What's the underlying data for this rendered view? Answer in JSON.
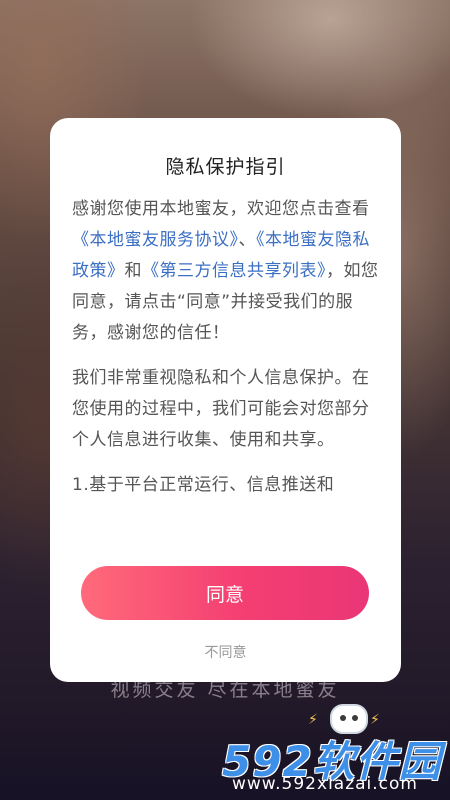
{
  "dialog": {
    "title": "隐私保护指引",
    "para1": {
      "text_before": "感谢您使用本地蜜友，欢迎您点击查看",
      "link_service": "《本地蜜友服务协议》",
      "sep1": "、",
      "link_privacy": "《本地蜜友隐私政策》",
      "sep2": "和",
      "link_thirdparty": "《第三方信息共享列表》",
      "text_after": "，如您同意，请点击“同意”并接受我们的服务，感谢您的信任！"
    },
    "para2": "我们非常重视隐私和个人信息保护。在您使用的过程中，我们可能会对您部分个人信息进行收集、使用和共享。",
    "para3": "1.基于平台正常运行、信息推送和",
    "agree_label": "同意",
    "disagree_label": "不同意"
  },
  "background": {
    "slogan": "视频交友 尽在本地蜜友"
  },
  "watermark": {
    "logo_text": "592软件园",
    "url": "www.592xiazai.com",
    "mascot_icon": "gamepad-mascot-icon"
  },
  "colors": {
    "accent_start": "#ff6a7a",
    "accent_end": "#ea3676",
    "link": "#3b6fc4",
    "watermark_blue": "#3d8fe8"
  }
}
